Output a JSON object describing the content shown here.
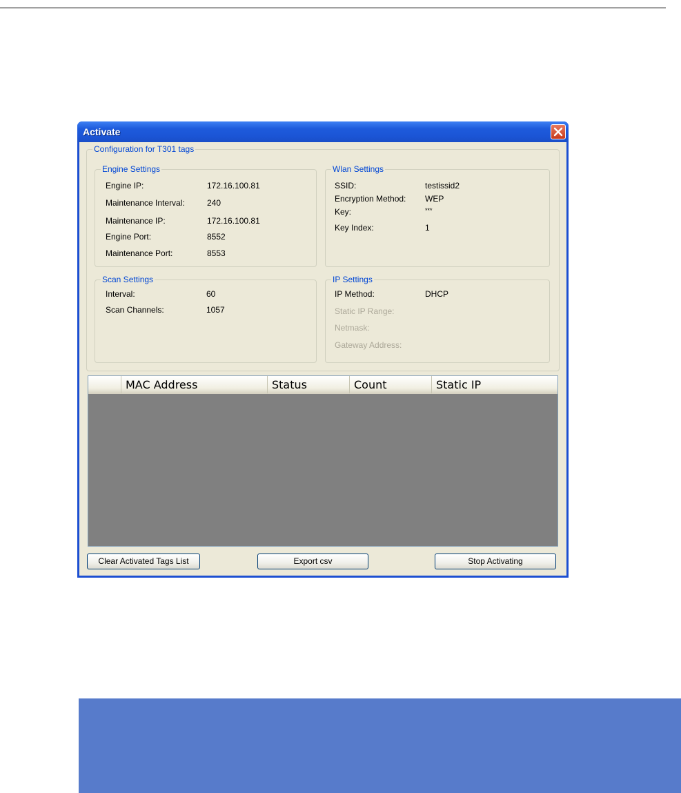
{
  "window": {
    "title": "Activate"
  },
  "config": {
    "legend": "Configuration for T301 tags"
  },
  "engine": {
    "legend": "Engine Settings",
    "rows": [
      {
        "label": "Engine IP:",
        "value": "172.16.100.81"
      },
      {
        "label": "Maintenance Interval:",
        "value": "240"
      },
      {
        "label": "Maintenance IP:",
        "value": "172.16.100.81"
      },
      {
        "label": "Engine Port:",
        "value": "8552"
      },
      {
        "label": "Maintenance Port:",
        "value": "8553"
      }
    ]
  },
  "wlan": {
    "legend": "Wlan Settings",
    "rows": [
      {
        "label": "SSID:",
        "value": "testissid2"
      },
      {
        "label": "Encryption Method:",
        "value": "WEP"
      },
      {
        "label": "Key:",
        "value": "***"
      },
      {
        "label": "Key Index:",
        "value": "1"
      }
    ]
  },
  "scan": {
    "legend": "Scan Settings",
    "rows": [
      {
        "label": "Interval:",
        "value": "60"
      },
      {
        "label": "Scan Channels:",
        "value": "1057"
      }
    ]
  },
  "ip": {
    "legend": "IP Settings",
    "method_label": "IP Method:",
    "method_value": "DHCP",
    "static_range_label": "Static IP Range:",
    "netmask_label": "Netmask:",
    "gateway_label": "Gateway Address:"
  },
  "table": {
    "columns": [
      "MAC Address",
      "Status",
      "Count",
      "Static IP"
    ]
  },
  "buttons": {
    "clear": "Clear Activated Tags List",
    "export": "Export csv",
    "stop": "Stop Activating"
  }
}
